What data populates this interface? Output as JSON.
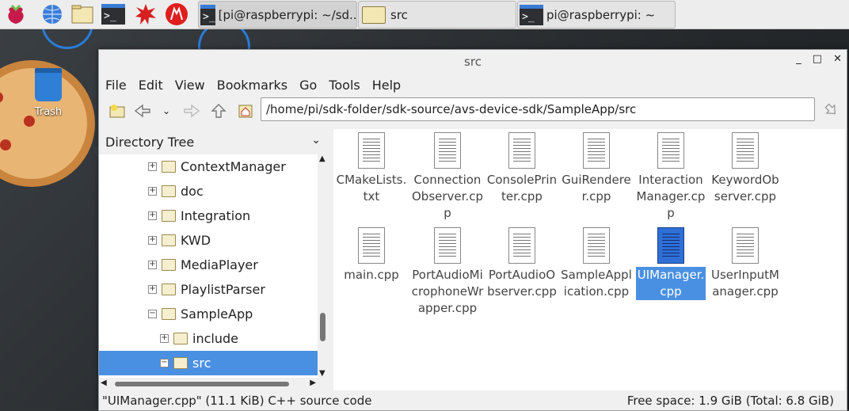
{
  "taskbar": {
    "launchers": [
      "raspberry-menu-icon",
      "web-browser-icon",
      "file-manager-icon",
      "terminal-icon",
      "mathematica-icon",
      "wolfram-icon"
    ],
    "tasks": [
      {
        "label": "[pi@raspberrypi: ~/sd...",
        "icon": "terminal-icon"
      },
      {
        "label": "src",
        "icon": "folder-icon"
      },
      {
        "label": "pi@raspberrypi: ~",
        "icon": "terminal-icon"
      }
    ]
  },
  "desktop": {
    "trash_label": "Trash"
  },
  "window": {
    "title": "src",
    "controls": {
      "minimize": "_",
      "maximize": "□",
      "close": "✕"
    }
  },
  "menu": [
    "File",
    "Edit",
    "View",
    "Bookmarks",
    "Go",
    "Tools",
    "Help"
  ],
  "toolbar": {
    "path": "/home/pi/sdk-folder/sdk-source/avs-device-sdk/SampleApp/src"
  },
  "side_panel": {
    "title": "Directory Tree",
    "items": [
      {
        "label": "ContextManager",
        "expander": "+",
        "indent": 0
      },
      {
        "label": "doc",
        "expander": "+",
        "indent": 0
      },
      {
        "label": "Integration",
        "expander": "+",
        "indent": 0
      },
      {
        "label": "KWD",
        "expander": "+",
        "indent": 0
      },
      {
        "label": "MediaPlayer",
        "expander": "+",
        "indent": 0
      },
      {
        "label": "PlaylistParser",
        "expander": "+",
        "indent": 0
      },
      {
        "label": "SampleApp",
        "expander": "−",
        "indent": 0
      },
      {
        "label": "include",
        "expander": "+",
        "indent": 1
      },
      {
        "label": "src",
        "expander": "−",
        "indent": 1,
        "selected": true
      }
    ]
  },
  "files": [
    {
      "name": "CMakeLists.txt",
      "lines": [
        "CMakeLists.",
        "txt"
      ]
    },
    {
      "name": "ConnectionObserver.cpp",
      "lines": [
        "Connection",
        "Observer.cp",
        "p"
      ]
    },
    {
      "name": "ConsolePrinter.cpp",
      "lines": [
        "ConsolePrin",
        "ter.cpp"
      ]
    },
    {
      "name": "GuiRenderer.cpp",
      "lines": [
        "GuiRendere",
        "r.cpp"
      ]
    },
    {
      "name": "InteractionManager.cpp",
      "lines": [
        "Interaction",
        "Manager.cp",
        "p"
      ]
    },
    {
      "name": "KeywordObserver.cpp",
      "lines": [
        "KeywordOb",
        "server.cpp"
      ]
    },
    {
      "name": "main.cpp",
      "lines": [
        "main.cpp"
      ]
    },
    {
      "name": "PortAudioMicrophoneWrapper.cpp",
      "lines": [
        "PortAudioMi",
        "crophoneWr",
        "apper.cpp"
      ]
    },
    {
      "name": "PortAudioObserver.cpp",
      "lines": [
        "PortAudioO",
        "bserver.cpp"
      ]
    },
    {
      "name": "SampleApplication.cpp",
      "lines": [
        "SampleAppl",
        "ication.cpp"
      ]
    },
    {
      "name": "UIManager.cpp",
      "lines": [
        "UIManager.",
        "cpp"
      ],
      "selected": true
    },
    {
      "name": "UserInputManager.cpp",
      "lines": [
        "UserInputM",
        "anager.cpp"
      ]
    }
  ],
  "status": {
    "selection": "\"UIManager.cpp\" (11.1 KiB) C++ source code",
    "free_space": "Free space: 1.9 GiB (Total: 6.8 GiB)"
  },
  "colors": {
    "selection": "#4a90e2",
    "accent": "#3a7bd5"
  }
}
